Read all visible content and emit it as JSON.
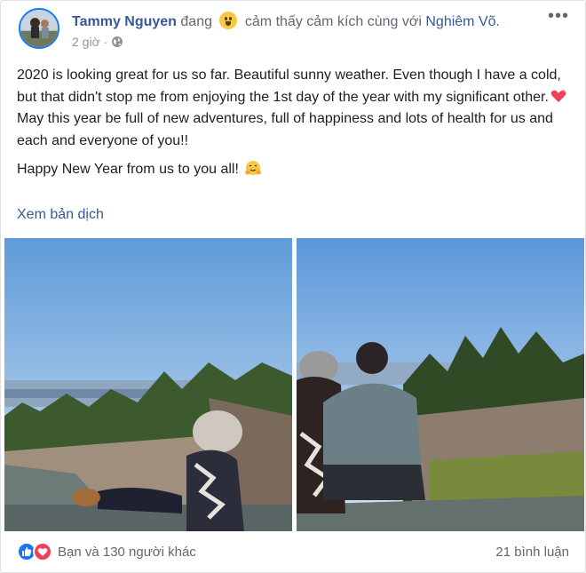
{
  "post": {
    "author_name": "Tammy Nguyen",
    "feeling_prefix": "đang",
    "feeling_text": "cảm thấy cảm kích cùng với",
    "tagged_name": "Nghiêm Võ.",
    "timestamp": "2 giờ",
    "time_separator": "·",
    "more_label": "•••",
    "text_line_1": "2020 is looking great for us so far. Beautiful sunny weather. Even though I have a cold, but that didn't stop me from enjoying the 1st day of the year with my significant other.",
    "text_line_2": "May this year be full of new adventures, full of happiness and lots of health for us and each and everyone of you!!",
    "text_line_3": "Happy New Year from us to you all!",
    "translate_label": "Xem bản dịch"
  },
  "reactions": {
    "summary": "Bạn và 130 người khác",
    "comments": "21 bình luận"
  },
  "icons": {
    "feeling": "smiling-emoji-icon",
    "privacy": "globe-icon",
    "heart": "heart-emoji-icon",
    "hug": "hugging-emoji-icon",
    "like": "like-reaction-icon",
    "love": "love-reaction-icon"
  },
  "colors": {
    "link": "#385898",
    "meta": "#90949c",
    "like": "#1877f2",
    "love": "#f33e58"
  }
}
